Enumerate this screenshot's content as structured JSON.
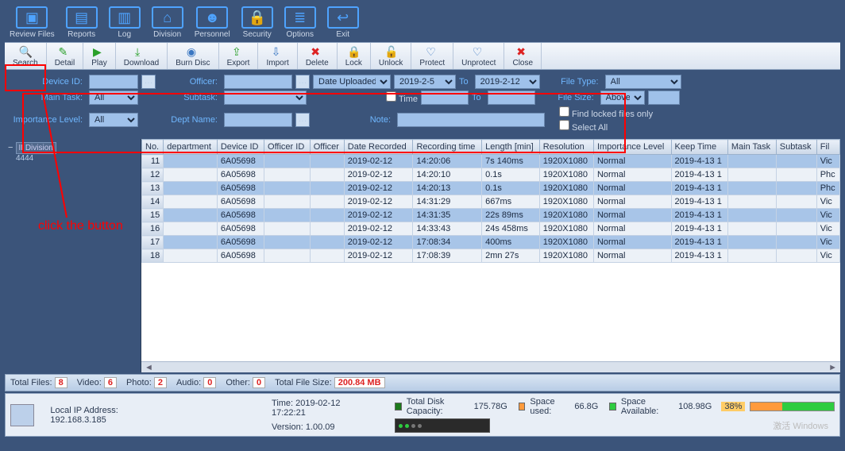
{
  "top_toolbar": [
    {
      "key": "review",
      "label": "Review Files",
      "icon": "folder"
    },
    {
      "key": "reports",
      "label": "Reports",
      "icon": "book"
    },
    {
      "key": "log",
      "label": "Log",
      "icon": "notes"
    },
    {
      "key": "division",
      "label": "Division",
      "icon": "group"
    },
    {
      "key": "personnel",
      "label": "Personnel",
      "icon": "person"
    },
    {
      "key": "security",
      "label": "Security",
      "icon": "lock"
    },
    {
      "key": "options",
      "label": "Options",
      "icon": "list"
    },
    {
      "key": "exit",
      "label": "Exit",
      "icon": "exit"
    }
  ],
  "action_bar": [
    {
      "key": "search",
      "label": "Search",
      "color": "#2aa02a"
    },
    {
      "key": "detail",
      "label": "Detail",
      "color": "#2aa02a"
    },
    {
      "key": "play",
      "label": "Play",
      "color": "#2aa02a"
    },
    {
      "key": "download",
      "label": "Download",
      "color": "#2aa02a"
    },
    {
      "key": "burn",
      "label": "Burn Disc",
      "color": "#3a77c2"
    },
    {
      "key": "export",
      "label": "Export",
      "color": "#2aa02a"
    },
    {
      "key": "import",
      "label": "Import",
      "color": "#3a77c2"
    },
    {
      "key": "delete",
      "label": "Delete",
      "color": "#d22"
    },
    {
      "key": "lock",
      "label": "Lock",
      "color": "#3a77c2"
    },
    {
      "key": "unlock",
      "label": "Unlock",
      "color": "#3a77c2"
    },
    {
      "key": "protect",
      "label": "Protect",
      "color": "#3a77c2"
    },
    {
      "key": "unprotect",
      "label": "Unprotect",
      "color": "#3a77c2"
    },
    {
      "key": "close",
      "label": "Close",
      "color": "#d22"
    }
  ],
  "filters": {
    "device_id_label": "Device ID:",
    "device_id": "",
    "officer_label": "Officer:",
    "officer": "",
    "date_uploaded_label": "Date Uploaded",
    "date_from": "2019-2-5",
    "to_label": "To",
    "date_to": "2019-2-12",
    "file_type_label": "File Type:",
    "file_type": "All",
    "main_task_label": "Main Task:",
    "main_task": "All",
    "subtask_label": "Subtask:",
    "subtask": "",
    "time_label": "Time",
    "time_from": "",
    "time_to": "",
    "file_size_label": "File Size:",
    "file_size_mode": "Above",
    "file_size_val": "",
    "importance_label": "Importance Level:",
    "importance": "All",
    "dept_label": "Dept Name:",
    "dept": "",
    "note_label": "Note:",
    "note": "",
    "find_locked_label": "Find locked files only",
    "select_all_label": "Select All"
  },
  "annotation": "click the button",
  "tree": {
    "root": "II Division",
    "count": "4444"
  },
  "columns": [
    "No.",
    "department",
    "Device ID",
    "Officer ID",
    "Officer",
    "Date Recorded",
    "Recording time",
    "Length [min]",
    "Resolution",
    "Importance Level",
    "Keep Time",
    "Main Task",
    "Subtask",
    "Fil"
  ],
  "rows": [
    {
      "no": "11",
      "dept": "",
      "dev": "6A05698",
      "oid": "",
      "off": "",
      "date": "2019-02-12",
      "time": "14:20:06",
      "len": "7s 140ms",
      "res": "1920X1080",
      "imp": "Normal",
      "keep": "2019-4-13 1",
      "mt": "",
      "st": "",
      "ft": "Vic"
    },
    {
      "no": "12",
      "dept": "",
      "dev": "6A05698",
      "oid": "",
      "off": "",
      "date": "2019-02-12",
      "time": "14:20:10",
      "len": "0.1s",
      "res": "1920X1080",
      "imp": "Normal",
      "keep": "2019-4-13 1",
      "mt": "",
      "st": "",
      "ft": "Phc"
    },
    {
      "no": "13",
      "dept": "",
      "dev": "6A05698",
      "oid": "",
      "off": "",
      "date": "2019-02-12",
      "time": "14:20:13",
      "len": "0.1s",
      "res": "1920X1080",
      "imp": "Normal",
      "keep": "2019-4-13 1",
      "mt": "",
      "st": "",
      "ft": "Phc"
    },
    {
      "no": "14",
      "dept": "",
      "dev": "6A05698",
      "oid": "",
      "off": "",
      "date": "2019-02-12",
      "time": "14:31:29",
      "len": "667ms",
      "res": "1920X1080",
      "imp": "Normal",
      "keep": "2019-4-13 1",
      "mt": "",
      "st": "",
      "ft": "Vic"
    },
    {
      "no": "15",
      "dept": "",
      "dev": "6A05698",
      "oid": "",
      "off": "",
      "date": "2019-02-12",
      "time": "14:31:35",
      "len": "22s 89ms",
      "res": "1920X1080",
      "imp": "Normal",
      "keep": "2019-4-13 1",
      "mt": "",
      "st": "",
      "ft": "Vic"
    },
    {
      "no": "16",
      "dept": "",
      "dev": "6A05698",
      "oid": "",
      "off": "",
      "date": "2019-02-12",
      "time": "14:33:43",
      "len": "24s 458ms",
      "res": "1920X1080",
      "imp": "Normal",
      "keep": "2019-4-13 1",
      "mt": "",
      "st": "",
      "ft": "Vic"
    },
    {
      "no": "17",
      "dept": "",
      "dev": "6A05698",
      "oid": "",
      "off": "",
      "date": "2019-02-12",
      "time": "17:08:34",
      "len": "400ms",
      "res": "1920X1080",
      "imp": "Normal",
      "keep": "2019-4-13 1",
      "mt": "",
      "st": "",
      "ft": "Vic"
    },
    {
      "no": "18",
      "dept": "",
      "dev": "6A05698",
      "oid": "",
      "off": "",
      "date": "2019-02-12",
      "time": "17:08:39",
      "len": "2mn 27s",
      "res": "1920X1080",
      "imp": "Normal",
      "keep": "2019-4-13 1",
      "mt": "",
      "st": "",
      "ft": "Vic"
    }
  ],
  "totals": {
    "total_files_label": "Total Files:",
    "total_files": "8",
    "video_label": "Video:",
    "video": "6",
    "photo_label": "Photo:",
    "photo": "2",
    "audio_label": "Audio:",
    "audio": "0",
    "other_label": "Other:",
    "other": "0",
    "total_size_label": "Total File Size:",
    "total_size": "200.84 MB"
  },
  "status": {
    "ip_label": "Local IP Address: ",
    "ip": "192.168.3.185",
    "time_label": "Time: ",
    "time": "2019-02-12 17:22:21",
    "version_label": "Version: ",
    "version": "1.00.09",
    "disk_total_label": "Total Disk Capacity: ",
    "disk_total": "175.78G",
    "space_used_label": "Space used: ",
    "space_used": "66.8G",
    "space_avail_label": "Space Available: ",
    "space_avail": "108.98G",
    "pct": "38%"
  },
  "watermark": {
    "line1": "激活 Windows",
    "line2": ""
  }
}
